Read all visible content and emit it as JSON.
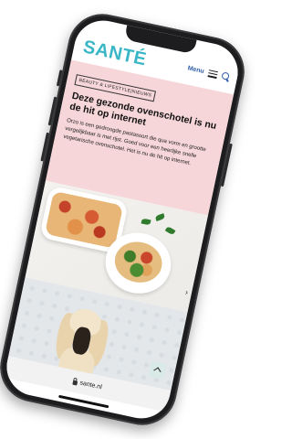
{
  "header": {
    "logo": "SANTÉ",
    "menu_label": "Menu"
  },
  "article": {
    "category_tag": "BEAUTY & LIFESTYLE|NIEUWS",
    "title": "Deze gezonde ovenschotel is nu de hit op internet",
    "intro": "Orzo is een gedroogde pastasoort die qua vorm en grootte vergelijkbaar is met rijst. Goed voor een heerlijke snelle vegetarische ovenschotel. Het is nu de hit op internet."
  },
  "browser": {
    "url": "sante.nl"
  },
  "colors": {
    "brand": "#39b6c6",
    "article_background": "#f6d6d8",
    "menu_accent": "#2f5fa8"
  },
  "icons": [
    "hamburger-icon",
    "search-icon",
    "chevron-right-icon",
    "chevron-up-icon",
    "lock-icon"
  ]
}
